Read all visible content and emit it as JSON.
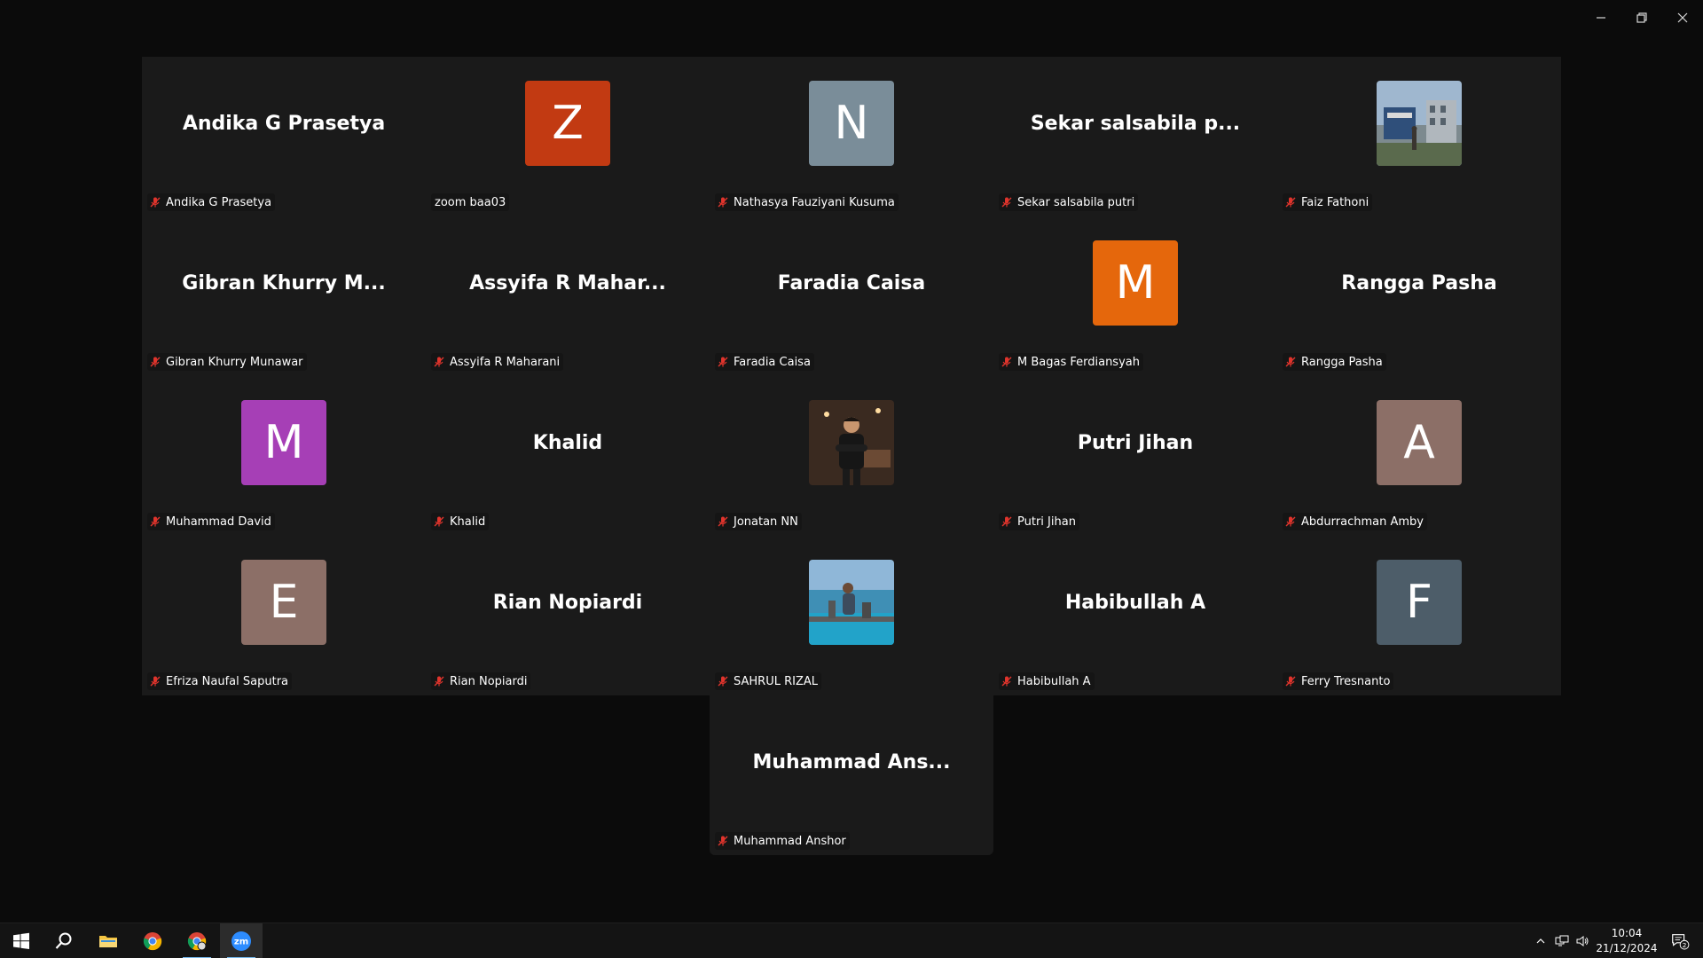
{
  "window": {
    "controls": {
      "minimize": "minimize-icon",
      "restore": "restore-icon",
      "close": "close-icon"
    }
  },
  "participants": [
    {
      "display": "Andika G Prasetya",
      "label": "Andika G Prasetya",
      "muted": true,
      "avatar": "name"
    },
    {
      "display": "",
      "label": "zoom baa03",
      "muted": false,
      "avatar": "initial",
      "initial": "Z",
      "color": "#c23a12"
    },
    {
      "display": "",
      "label": "Nathasya Fauziyani Kusuma",
      "muted": true,
      "avatar": "initial",
      "initial": "N",
      "color": "#7a8d99"
    },
    {
      "display": "Sekar salsabila p...",
      "label": "Sekar salsabila putri",
      "muted": true,
      "avatar": "name"
    },
    {
      "display": "",
      "label": "Faiz Fathoni",
      "muted": true,
      "avatar": "photo",
      "photo": "building-photo"
    },
    {
      "display": "Gibran Khurry M...",
      "label": "Gibran Khurry Munawar",
      "muted": true,
      "avatar": "name"
    },
    {
      "display": "Assyifa R Mahar...",
      "label": "Assyifa R Maharani",
      "muted": true,
      "avatar": "name"
    },
    {
      "display": "Faradia Caisa",
      "label": "Faradia Caisa",
      "muted": true,
      "avatar": "name"
    },
    {
      "display": "",
      "label": "M Bagas Ferdiansyah",
      "muted": true,
      "avatar": "initial",
      "initial": "M",
      "color": "#e5670c"
    },
    {
      "display": "Rangga Pasha",
      "label": "Rangga Pasha",
      "muted": true,
      "avatar": "name"
    },
    {
      "display": "",
      "label": "Muhammad David",
      "muted": true,
      "avatar": "initial",
      "initial": "M",
      "color": "#a63fb6"
    },
    {
      "display": "Khalid",
      "label": "Khalid",
      "muted": true,
      "avatar": "name"
    },
    {
      "display": "",
      "label": "Jonatan NN",
      "muted": true,
      "avatar": "photo",
      "photo": "person-photo"
    },
    {
      "display": "Putri Jihan",
      "label": "Putri Jihan",
      "muted": true,
      "avatar": "name"
    },
    {
      "display": "",
      "label": "Abdurrachman Amby",
      "muted": true,
      "avatar": "initial",
      "initial": "A",
      "color": "#8c6f67"
    },
    {
      "display": "",
      "label": "Efriza Naufal Saputra",
      "muted": true,
      "avatar": "initial",
      "initial": "E",
      "color": "#8c6f67"
    },
    {
      "display": "Rian Nopiardi",
      "label": "Rian Nopiardi",
      "muted": true,
      "avatar": "name"
    },
    {
      "display": "",
      "label": "SAHRUL RIZAL",
      "muted": true,
      "avatar": "photo",
      "photo": "sea-photo"
    },
    {
      "display": "Habibullah A",
      "label": "Habibullah A",
      "muted": true,
      "avatar": "name"
    },
    {
      "display": "",
      "label": "Ferry Tresnanto",
      "muted": true,
      "avatar": "initial",
      "initial": "F",
      "color": "#4d5d69"
    }
  ],
  "last_participant": {
    "display": "Muhammad  Ans...",
    "label": "Muhammad Anshor",
    "muted": true
  },
  "taskbar": {
    "apps": [
      "windows-start-icon",
      "search-icon",
      "file-explorer-icon",
      "chrome-icon",
      "chrome-profile-icon",
      "zoom-icon"
    ],
    "zoom_label": "zm",
    "clock": {
      "time": "10:04",
      "date": "21/12/2024"
    },
    "notifications_count": "2",
    "tray_icons": [
      "chevron-up-icon",
      "network-icon",
      "volume-icon"
    ]
  },
  "colors": {
    "background": "#0b0b0b",
    "tile": "#1a1a1a",
    "muted_mic": "#e0342c",
    "taskbar": "#141414",
    "zoom_blue": "#2d8cff"
  }
}
